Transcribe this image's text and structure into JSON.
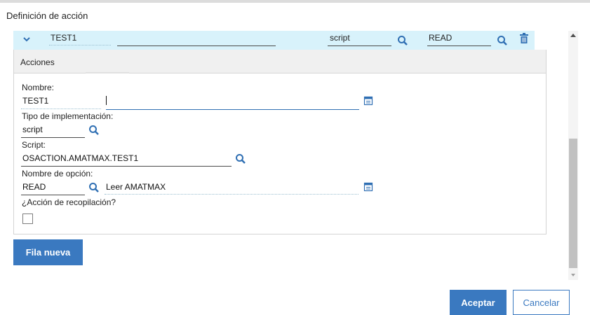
{
  "dialog": {
    "title": "Definición de acción"
  },
  "row": {
    "name": "TEST1",
    "type": "script",
    "option": "READ"
  },
  "panel": {
    "title": "Acciones"
  },
  "form": {
    "name_label": "Nombre:",
    "name_value": "TEST1",
    "impl_label": "Tipo de implementación:",
    "impl_value": "script",
    "script_label": "Script:",
    "script_value": "OSACTION.AMATMAX.TEST1",
    "option_label": "Nombre de opción:",
    "option_value": "READ",
    "option_desc": "Leer AMATMAX",
    "collect_label": "¿Acción de recopilación?",
    "collect_checked": false
  },
  "buttons": {
    "new_row": "Fila nueva",
    "accept": "Aceptar",
    "cancel": "Cancelar"
  },
  "colors": {
    "accent": "#3a79c0",
    "row_highlight": "#d8f2fb",
    "icon_blue": "#2f6fb3"
  }
}
